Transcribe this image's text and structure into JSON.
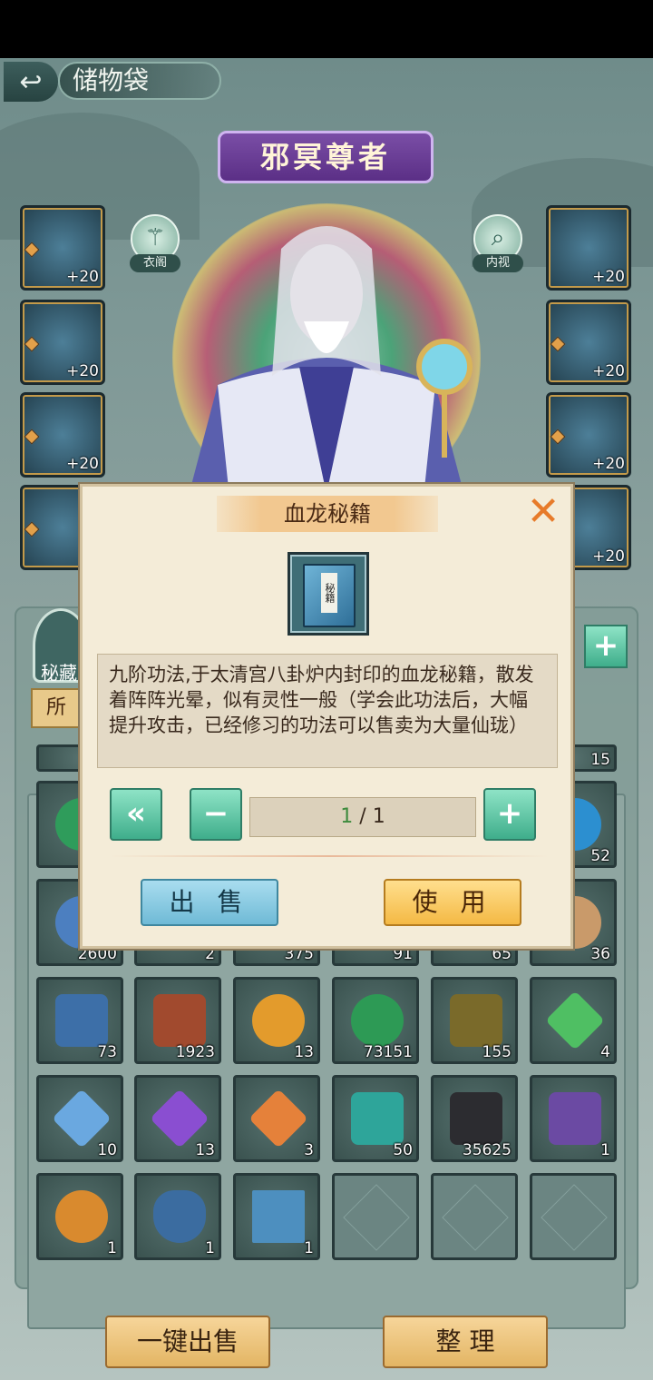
{
  "header": {
    "back_icon": "back-arrow-icon",
    "title": "储物袋"
  },
  "character": {
    "name": "邪冥尊者",
    "buttons": [
      {
        "label": "衣阁",
        "icon": "wardrobe-icon"
      },
      {
        "label": "内视",
        "icon": "magnifier-icon"
      }
    ]
  },
  "equipment": {
    "left": [
      {
        "name": "sword",
        "level": "+20"
      },
      {
        "name": "helmet",
        "level": "+20"
      },
      {
        "name": "robe",
        "level": "+20"
      },
      {
        "name": "boots",
        "level": "+"
      }
    ],
    "right": [
      {
        "name": "ring",
        "level": "+20"
      },
      {
        "name": "pendant",
        "level": "+20"
      },
      {
        "name": "bracelet",
        "level": "+20"
      },
      {
        "name": "belt",
        "level": "+20"
      }
    ]
  },
  "bag": {
    "tab_label": "秘藏",
    "filter_label": "所",
    "partial_counts": {
      "top_right": "15",
      "row2_right": "52"
    },
    "row3": [
      {
        "count": "2600"
      },
      {
        "count": "2"
      },
      {
        "count": "375"
      },
      {
        "count": "91"
      },
      {
        "count": "65"
      },
      {
        "count": "36"
      }
    ],
    "row4": [
      {
        "name": "jade-token",
        "count": "73",
        "color": "#3d6fa8"
      },
      {
        "name": "red-ore",
        "count": "1923",
        "color": "#a14a2e"
      },
      {
        "name": "golden-orb",
        "count": "13",
        "color": "#e39b2c"
      },
      {
        "name": "jade-ring",
        "count": "73151",
        "color": "#2d9a55"
      },
      {
        "name": "herb-box",
        "count": "155",
        "color": "#7a6a2a"
      },
      {
        "name": "green-crystal",
        "count": "4",
        "color": "#4fbf63"
      }
    ],
    "row5": [
      {
        "name": "blue-crystal",
        "count": "10",
        "color": "#6aa8e0"
      },
      {
        "name": "purple-crystal",
        "count": "13",
        "color": "#8a4ed1"
      },
      {
        "name": "orange-crystal",
        "count": "3",
        "color": "#e5813a"
      },
      {
        "name": "teal-ore",
        "count": "50",
        "color": "#2ea59a"
      },
      {
        "name": "black-ore",
        "count": "35625",
        "color": "#2c2c30"
      },
      {
        "name": "scroll",
        "count": "1",
        "color": "#6b4aa3"
      }
    ],
    "row6": [
      {
        "name": "beast-seal",
        "count": "1",
        "color": "#d98a2e"
      },
      {
        "name": "pouch",
        "count": "1",
        "color": "#3b6ca0"
      },
      {
        "name": "secret-book",
        "count": "1",
        "color": "#4d8fbf"
      }
    ],
    "one_click_sell": "一键出售",
    "arrange": "整 理",
    "add_icon": "plus-icon"
  },
  "modal": {
    "title": "血龙秘籍",
    "close_icon": "close-x-icon",
    "book_label": "秘籍",
    "description": "九阶功法,于太清宫八卦炉内封印的血龙秘籍，散发着阵阵光晕，似有灵性一般（学会此功法后，大幅提升攻击，已经修习的功法可以售卖为大量仙珑）",
    "max_icon": "double-left-icon",
    "minus_icon": "minus-icon",
    "plus_icon": "plus-icon",
    "quantity_current": "1",
    "quantity_total": " / 1",
    "sell_label": "出 售",
    "use_label": "使 用"
  }
}
